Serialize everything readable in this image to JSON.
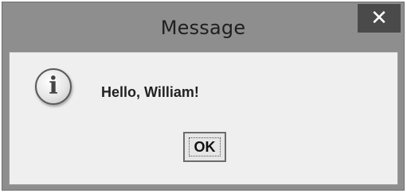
{
  "window": {
    "title": "Message",
    "close_glyph": "✕"
  },
  "dialog": {
    "icon": "info-icon",
    "icon_glyph": "i",
    "message": "Hello, William!",
    "ok_label": "OK"
  },
  "colors": {
    "frame": "#8e8e8e",
    "close_button": "#4a4a4a",
    "content_background": "#efefef"
  }
}
